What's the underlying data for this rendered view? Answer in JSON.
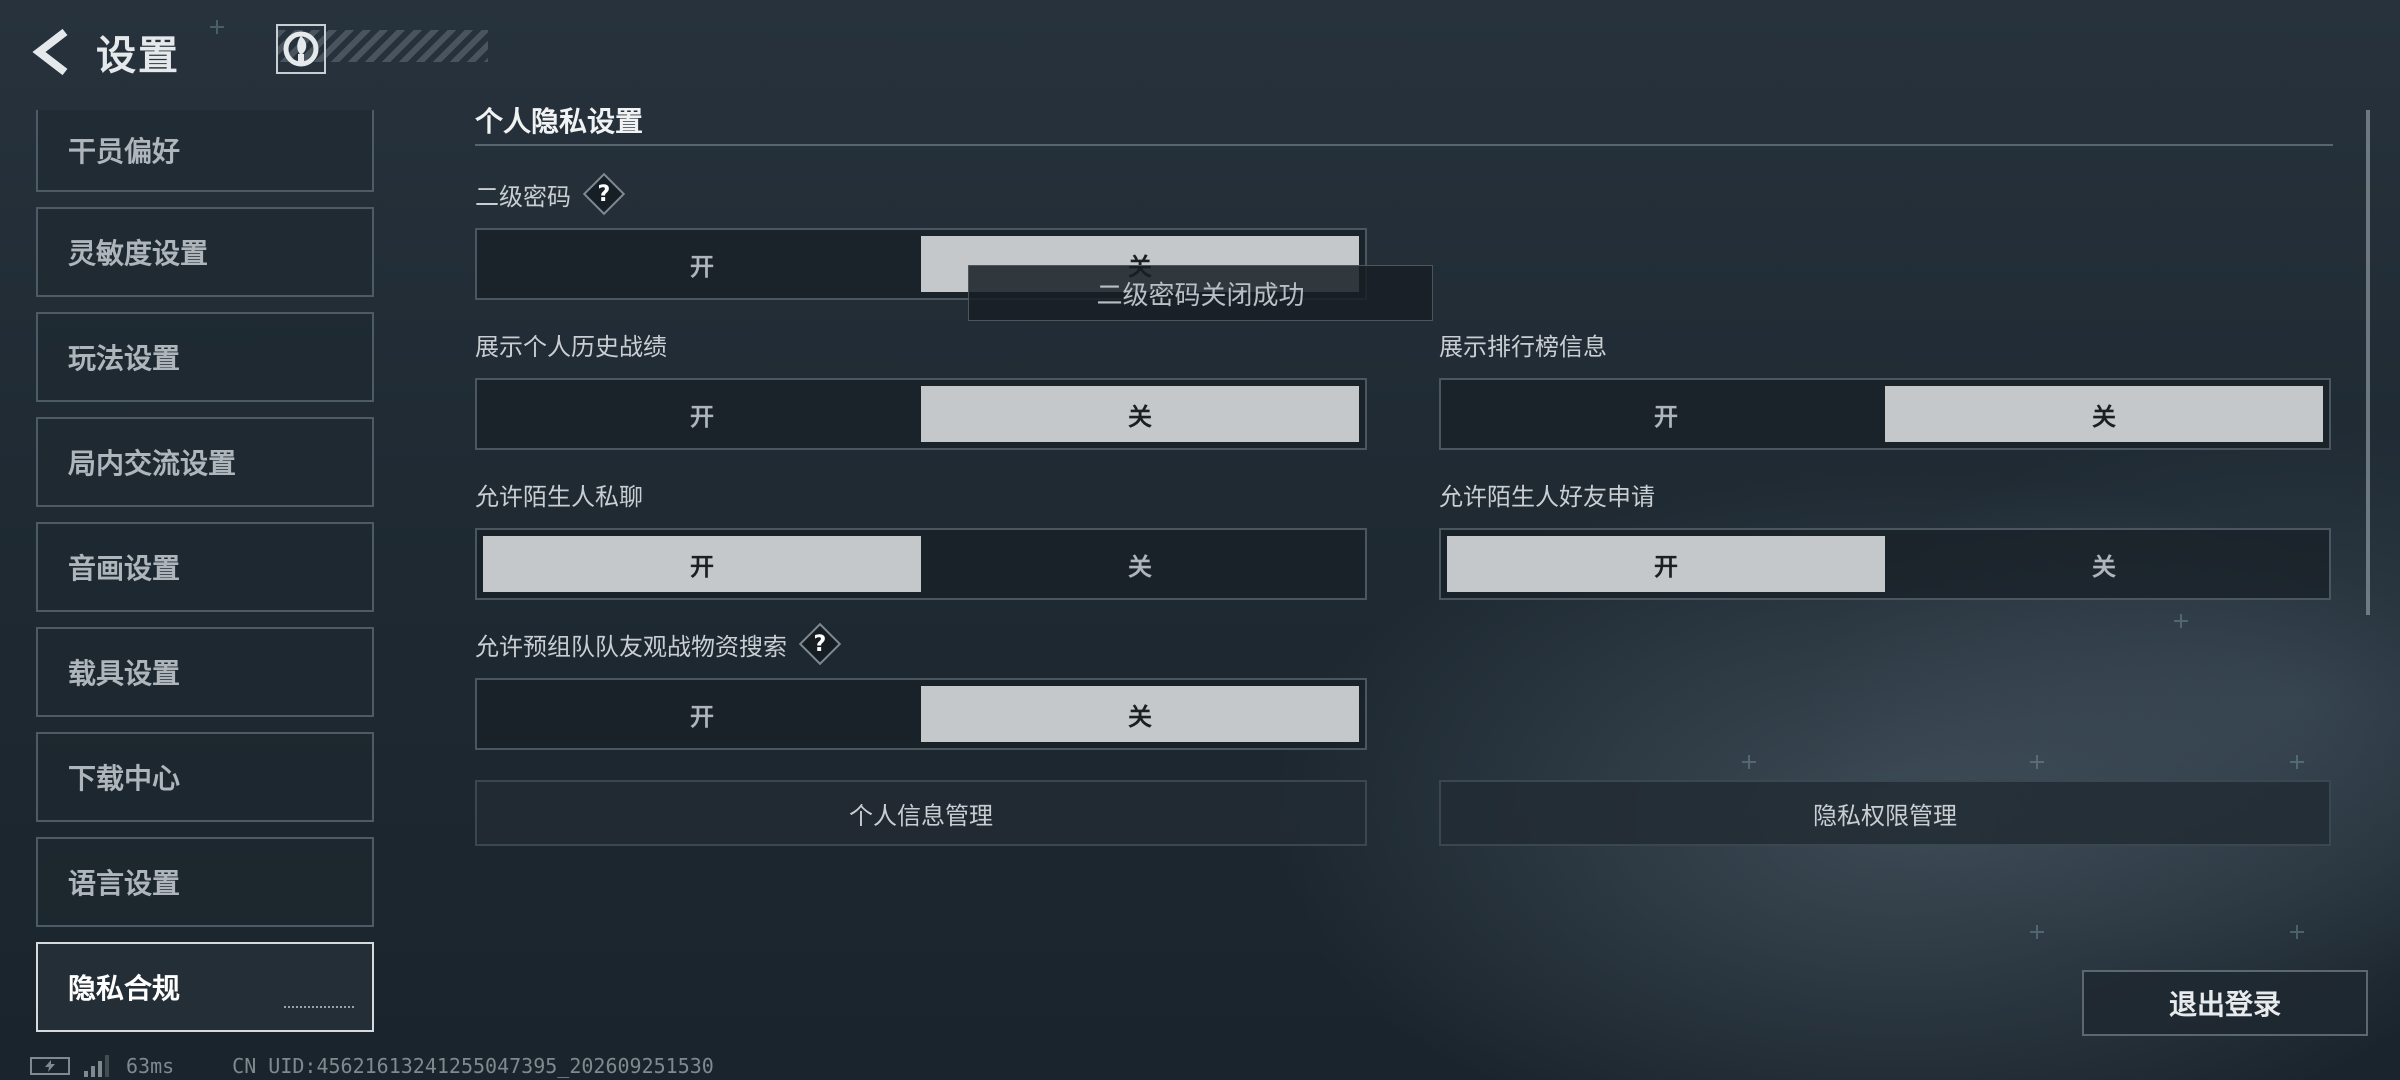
{
  "header": {
    "title": "设置",
    "back_icon": "back-arrow-icon",
    "logo_icon": "game-logo-icon"
  },
  "sidebar": {
    "items": [
      {
        "label": "干员偏好"
      },
      {
        "label": "灵敏度设置"
      },
      {
        "label": "玩法设置"
      },
      {
        "label": "局内交流设置"
      },
      {
        "label": "音画设置"
      },
      {
        "label": "载具设置"
      },
      {
        "label": "下载中心"
      },
      {
        "label": "语言设置"
      },
      {
        "label": "隐私合规",
        "active": true
      }
    ]
  },
  "privacy": {
    "section_title": "个人隐私设置",
    "on_label": "开",
    "off_label": "关",
    "settings": {
      "secondary_password": {
        "label": "二级密码",
        "value": "关"
      },
      "show_history": {
        "label": "展示个人历史战绩",
        "value": "关"
      },
      "show_leaderboard": {
        "label": "展示排行榜信息",
        "value": "关"
      },
      "stranger_chat": {
        "label": "允许陌生人私聊",
        "value": "开"
      },
      "stranger_friend": {
        "label": "允许陌生人好友申请",
        "value": "开"
      },
      "team_spectate": {
        "label": "允许预组队队友观战物资搜索",
        "value": "关"
      }
    },
    "personal_info_btn": "个人信息管理",
    "privacy_perm_btn": "隐私权限管理"
  },
  "toast": "二级密码关闭成功",
  "logout_label": "退出登录",
  "status": {
    "ping": "63ms",
    "uid": "CN UID:45621613241255047395_202609251530"
  },
  "colors": {
    "selected_bg": "#c4c8cb",
    "background": "#1f2a33",
    "accent_line": "#59646c"
  }
}
